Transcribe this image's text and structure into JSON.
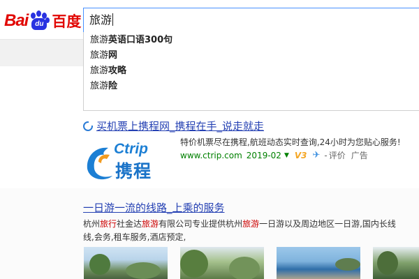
{
  "logo": {
    "left_text": "Bai",
    "paw_text": "du",
    "cn_text": "百度"
  },
  "search": {
    "value": "旅游"
  },
  "suggestions": [
    {
      "query": "旅游",
      "suffix": "英语口语300句"
    },
    {
      "query": "旅游",
      "suffix": "网"
    },
    {
      "query": "旅游",
      "suffix": "攻略"
    },
    {
      "query": "旅游",
      "suffix": "险"
    }
  ],
  "result1": {
    "title": "买机票上携程网_携程在手_说走就走",
    "logo_en": "Ctrip",
    "logo_cn": "携程",
    "desc": "特价机票尽在携程,航班动态实时查询,24小时为您贴心服务!",
    "url": "www.ctrip.com",
    "date": "2019-02",
    "v_badge": "V3",
    "eval": "评价",
    "ad": "广告",
    "dash": "-"
  },
  "result2": {
    "title": "一日游一流的线路_上乘的服务",
    "desc_parts": [
      {
        "t": "杭州",
        "hl": false
      },
      {
        "t": "旅行",
        "hl": true
      },
      {
        "t": "社金达",
        "hl": false
      },
      {
        "t": "旅游",
        "hl": true
      },
      {
        "t": "有限公司专业提供杭州",
        "hl": false
      },
      {
        "t": "旅游",
        "hl": true
      },
      {
        "t": "一日游以及周边地区一日游,国内长线",
        "hl": false
      }
    ],
    "desc_line2": "线,会务,租车服务,酒店预定,"
  },
  "colors": {
    "link": "#2440b3",
    "brand_red": "#e10602",
    "brand_blue": "#2932e1",
    "highlight": "#c00",
    "url_green": "#008000"
  }
}
